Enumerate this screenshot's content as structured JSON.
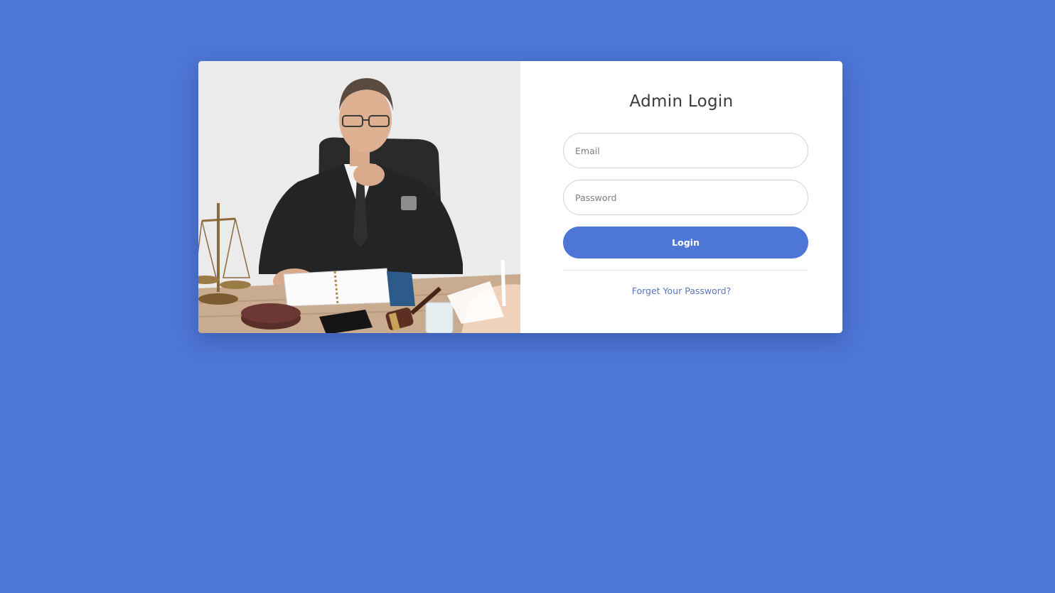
{
  "login": {
    "title": "Admin Login",
    "email_placeholder": "Email",
    "password_placeholder": "Password",
    "submit_label": "Login",
    "forgot_label": "Forget Your Password?"
  },
  "colors": {
    "background": "#4e76d6",
    "accent": "#4e76d6",
    "card": "#ffffff",
    "link": "#5a78b8"
  }
}
